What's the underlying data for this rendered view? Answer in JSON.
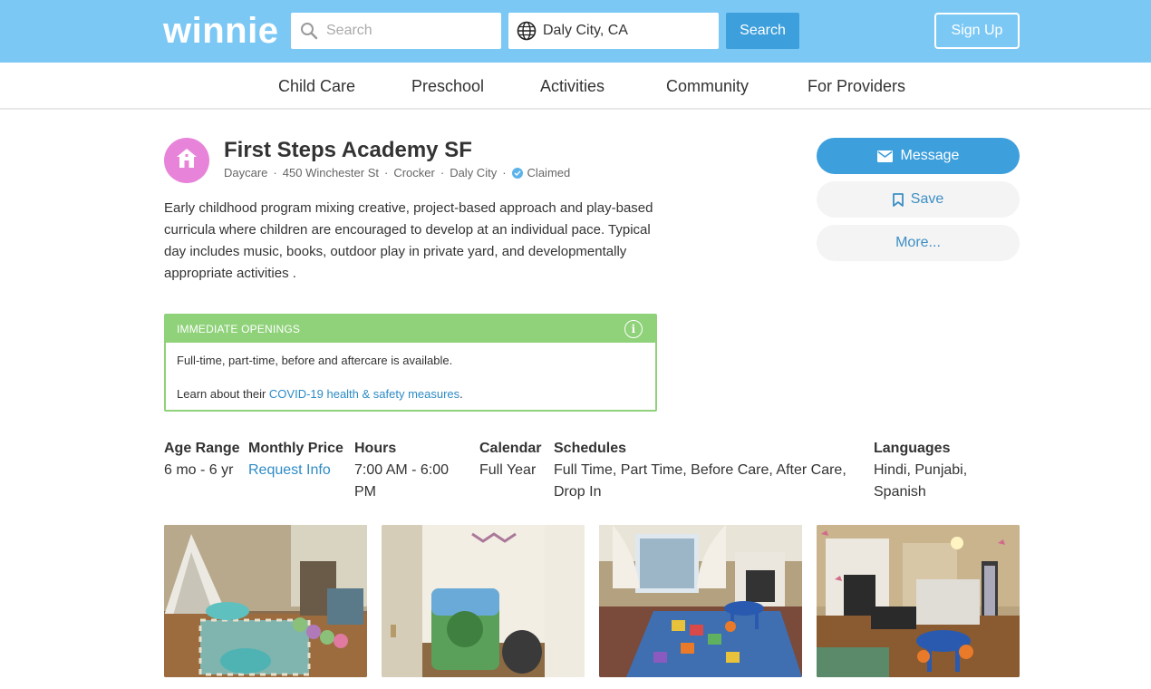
{
  "header": {
    "logo": "winnie",
    "search_placeholder": "Search",
    "location_value": "Daly City, CA",
    "search_button": "Search",
    "signup_button": "Sign Up"
  },
  "nav": {
    "items": [
      {
        "label": "Child Care"
      },
      {
        "label": "Preschool"
      },
      {
        "label": "Activities"
      },
      {
        "label": "Community"
      },
      {
        "label": "For Providers"
      }
    ]
  },
  "listing": {
    "title": "First Steps Academy SF",
    "type": "Daycare",
    "address": "450 Winchester St",
    "neighborhood": "Crocker",
    "city": "Daly City",
    "claimed": "Claimed",
    "description": "Early childhood program mixing creative, project-based approach and play-based curricula where children are encouraged to develop at an individual pace. Typical day includes music, books, outdoor play in private yard, and developmentally appropriate activities ."
  },
  "actions": {
    "message": "Message",
    "save": "Save",
    "more": "More..."
  },
  "openings": {
    "header": "IMMEDIATE OPENINGS",
    "text": "Full-time, part-time, before and aftercare is available.",
    "covid_prefix": "Learn about their ",
    "covid_link": "COVID-19 health & safety measures",
    "covid_suffix": "."
  },
  "details": {
    "age_range": {
      "label": "Age Range",
      "value": "6 mo - 6 yr"
    },
    "monthly_price": {
      "label": "Monthly Price",
      "value": "Request Info"
    },
    "hours": {
      "label": "Hours",
      "value": "7:00 AM - 6:00 PM"
    },
    "calendar": {
      "label": "Calendar",
      "value": "Full Year"
    },
    "schedules": {
      "label": "Schedules",
      "value": "Full Time, Part Time, Before Care, After Care, Drop In"
    },
    "languages": {
      "label": "Languages",
      "value": "Hindi, Punjabi, Spanish"
    }
  },
  "colors": {
    "header_bg": "#7cc8f5",
    "primary": "#3d9fdc",
    "link": "#2e8bc5",
    "openings_green": "#8fd27a",
    "avatar": "#e784d9"
  }
}
